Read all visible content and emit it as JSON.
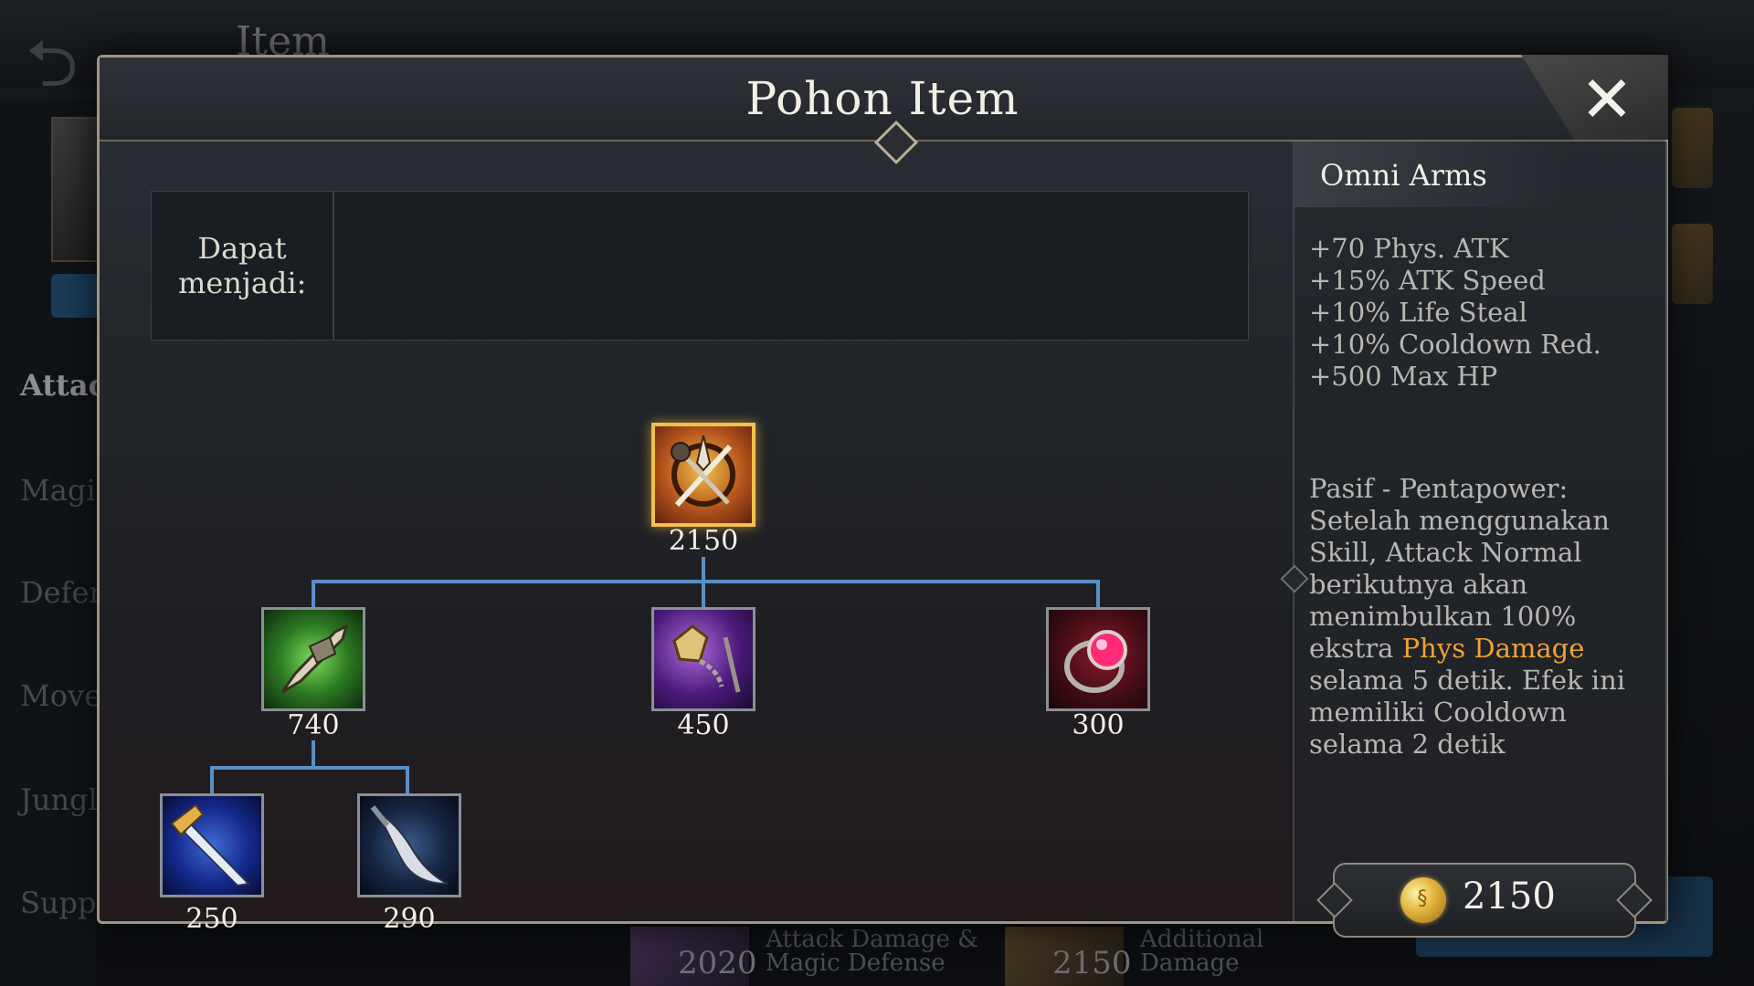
{
  "background": {
    "screen_title": "Item",
    "categories": [
      "Attac",
      "Magic",
      "Defen",
      "Move",
      "Jungl",
      "Supp"
    ],
    "bottom_items": [
      {
        "price": "2020",
        "label_line1": "Attack Damage &",
        "label_line2": "Magic Defense"
      },
      {
        "price": "2150",
        "label_line1": "Additional",
        "label_line2": "Damage"
      }
    ]
  },
  "modal": {
    "title": "Pohon Item",
    "close_icon": "close-icon",
    "upgrade_label": "Dapat menjadi:"
  },
  "tree": {
    "main": {
      "name": "Omni Arms",
      "price": "2150",
      "icon": "omni-arms-icon"
    },
    "components": [
      {
        "price": "740",
        "icon": "green-blade-icon"
      },
      {
        "price": "450",
        "icon": "purple-flail-icon"
      },
      {
        "price": "300",
        "icon": "ruby-ring-icon"
      }
    ],
    "subcomponents": [
      {
        "price": "250",
        "icon": "dagger-icon"
      },
      {
        "price": "290",
        "icon": "curved-blade-icon"
      }
    ]
  },
  "detail": {
    "item_name": "Omni Arms",
    "stats": [
      "+70 Phys. ATK",
      "+15% ATK Speed",
      "+10% Life Steal",
      "+10% Cooldown Red.",
      "+500 Max HP"
    ],
    "passive_before": "Pasif - Pentapower: Setelah menggunakan Skill, Attack Normal berikutnya akan menimbulkan 100% ekstra ",
    "passive_highlight": "Phys Damage",
    "passive_after": " selama 5 detik. Efek ini memiliki Cooldown selama 2 detik",
    "price": "2150",
    "highlight_color": "#f0a234",
    "coin_icon": "gold-coin-icon"
  }
}
